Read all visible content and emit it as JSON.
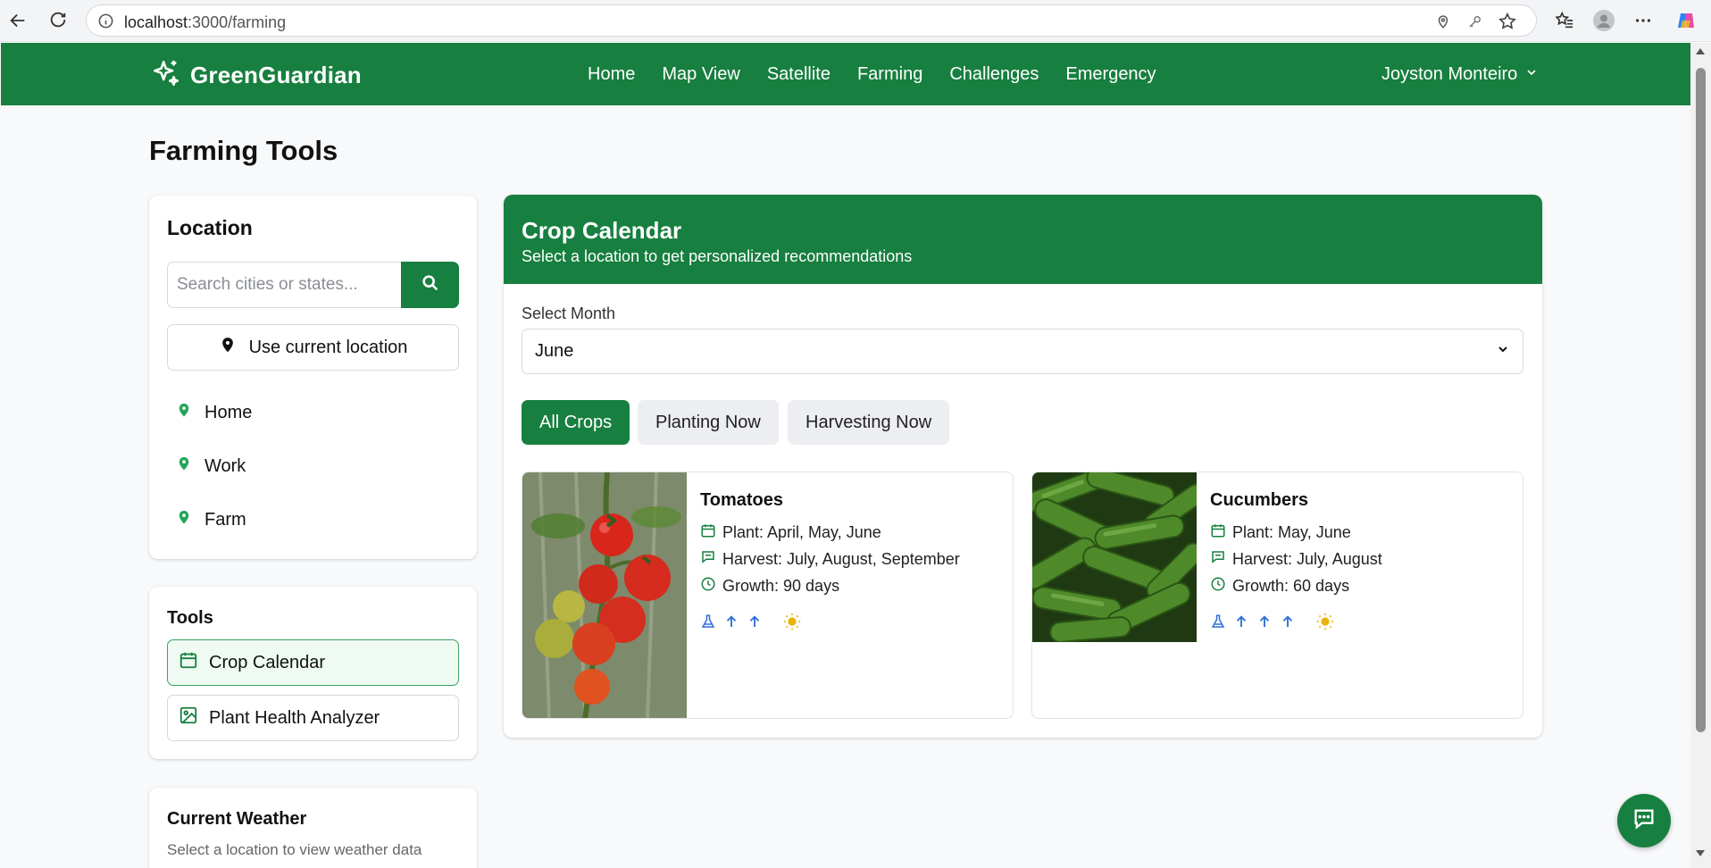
{
  "browser": {
    "url_host": "localhost",
    "url_path": ":3000/farming"
  },
  "header": {
    "brand": "GreenGuardian",
    "nav": [
      "Home",
      "Map View",
      "Satellite",
      "Farming",
      "Challenges",
      "Emergency"
    ],
    "user": "Joyston Monteiro"
  },
  "page": {
    "title": "Farming Tools"
  },
  "location": {
    "heading": "Location",
    "search_placeholder": "Search cities or states...",
    "current_location_label": "Use current location",
    "saved": [
      "Home",
      "Work",
      "Farm"
    ]
  },
  "tools": {
    "heading": "Tools",
    "items": [
      "Crop Calendar",
      "Plant Health Analyzer"
    ]
  },
  "weather": {
    "heading": "Current Weather",
    "subtitle": "Select a location to view weather data"
  },
  "calendar": {
    "title": "Crop Calendar",
    "subtitle": "Select a location to get personalized recommendations",
    "month_label": "Select Month",
    "month_value": "June",
    "filters": [
      "All Crops",
      "Planting Now",
      "Harvesting Now"
    ],
    "crops": [
      {
        "name": "Tomatoes",
        "plant": "Plant: April, May, June",
        "harvest": "Harvest: July, August, September",
        "growth": "Growth: 90 days",
        "water_arrows": 2
      },
      {
        "name": "Cucumbers",
        "plant": "Plant: May, June",
        "harvest": "Harvest: July, August",
        "growth": "Growth: 60 days",
        "water_arrows": 3
      }
    ]
  },
  "colors": {
    "brand_green": "#177f3f",
    "icon_blue": "#2f6fdb",
    "sun_yellow": "#eab308"
  }
}
